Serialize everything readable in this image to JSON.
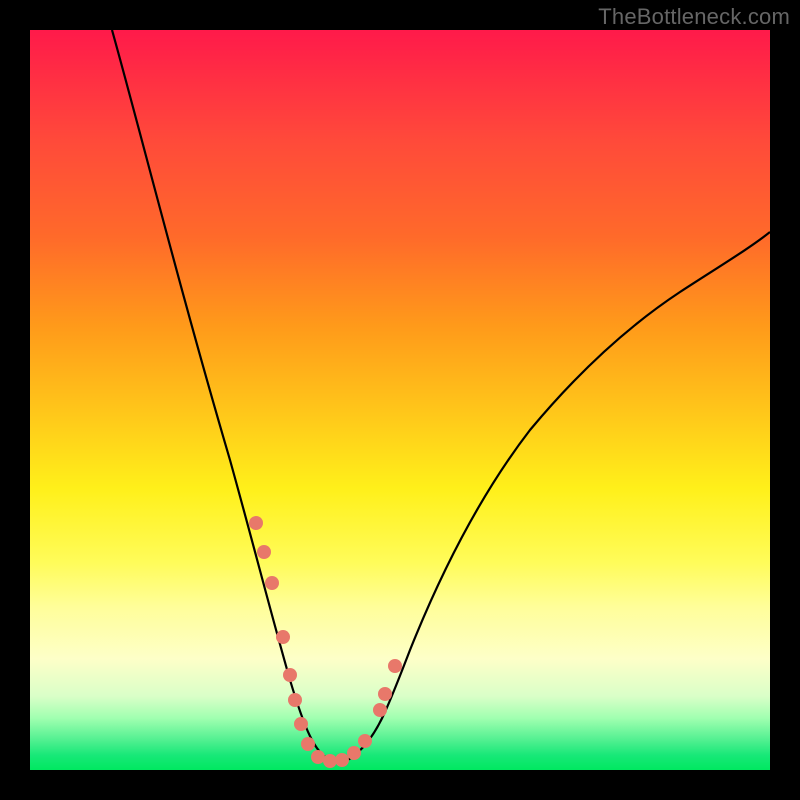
{
  "watermark": "TheBottleneck.com",
  "chart_data": {
    "type": "line",
    "title": "",
    "xlabel": "",
    "ylabel": "",
    "xlim": [
      0,
      100
    ],
    "ylim": [
      0,
      100
    ],
    "series": [
      {
        "name": "bottleneck-curve",
        "x": [
          11,
          15,
          20,
          25,
          28,
          30,
          32,
          34,
          36,
          38,
          40,
          42,
          44,
          47,
          50,
          55,
          60,
          65,
          70,
          75,
          80,
          85,
          90,
          95,
          100
        ],
        "y": [
          100,
          87,
          71,
          55,
          44,
          36,
          27,
          17,
          9,
          3,
          1,
          1,
          2,
          6,
          13,
          24,
          34,
          42,
          49,
          55,
          60,
          64,
          68,
          71,
          74
        ]
      }
    ],
    "highlight_points": {
      "name": "optimal-range-markers",
      "x": [
        30.5,
        32,
        34,
        36,
        38,
        40,
        42,
        44,
        47,
        47.8
      ],
      "y": [
        33,
        23,
        12,
        6,
        2,
        1,
        1,
        3,
        9,
        13
      ]
    },
    "background_gradient": {
      "top_color": "#ff1a4a",
      "bottom_color": "#00e860",
      "description": "red-orange-yellow-green vertical gradient"
    }
  }
}
